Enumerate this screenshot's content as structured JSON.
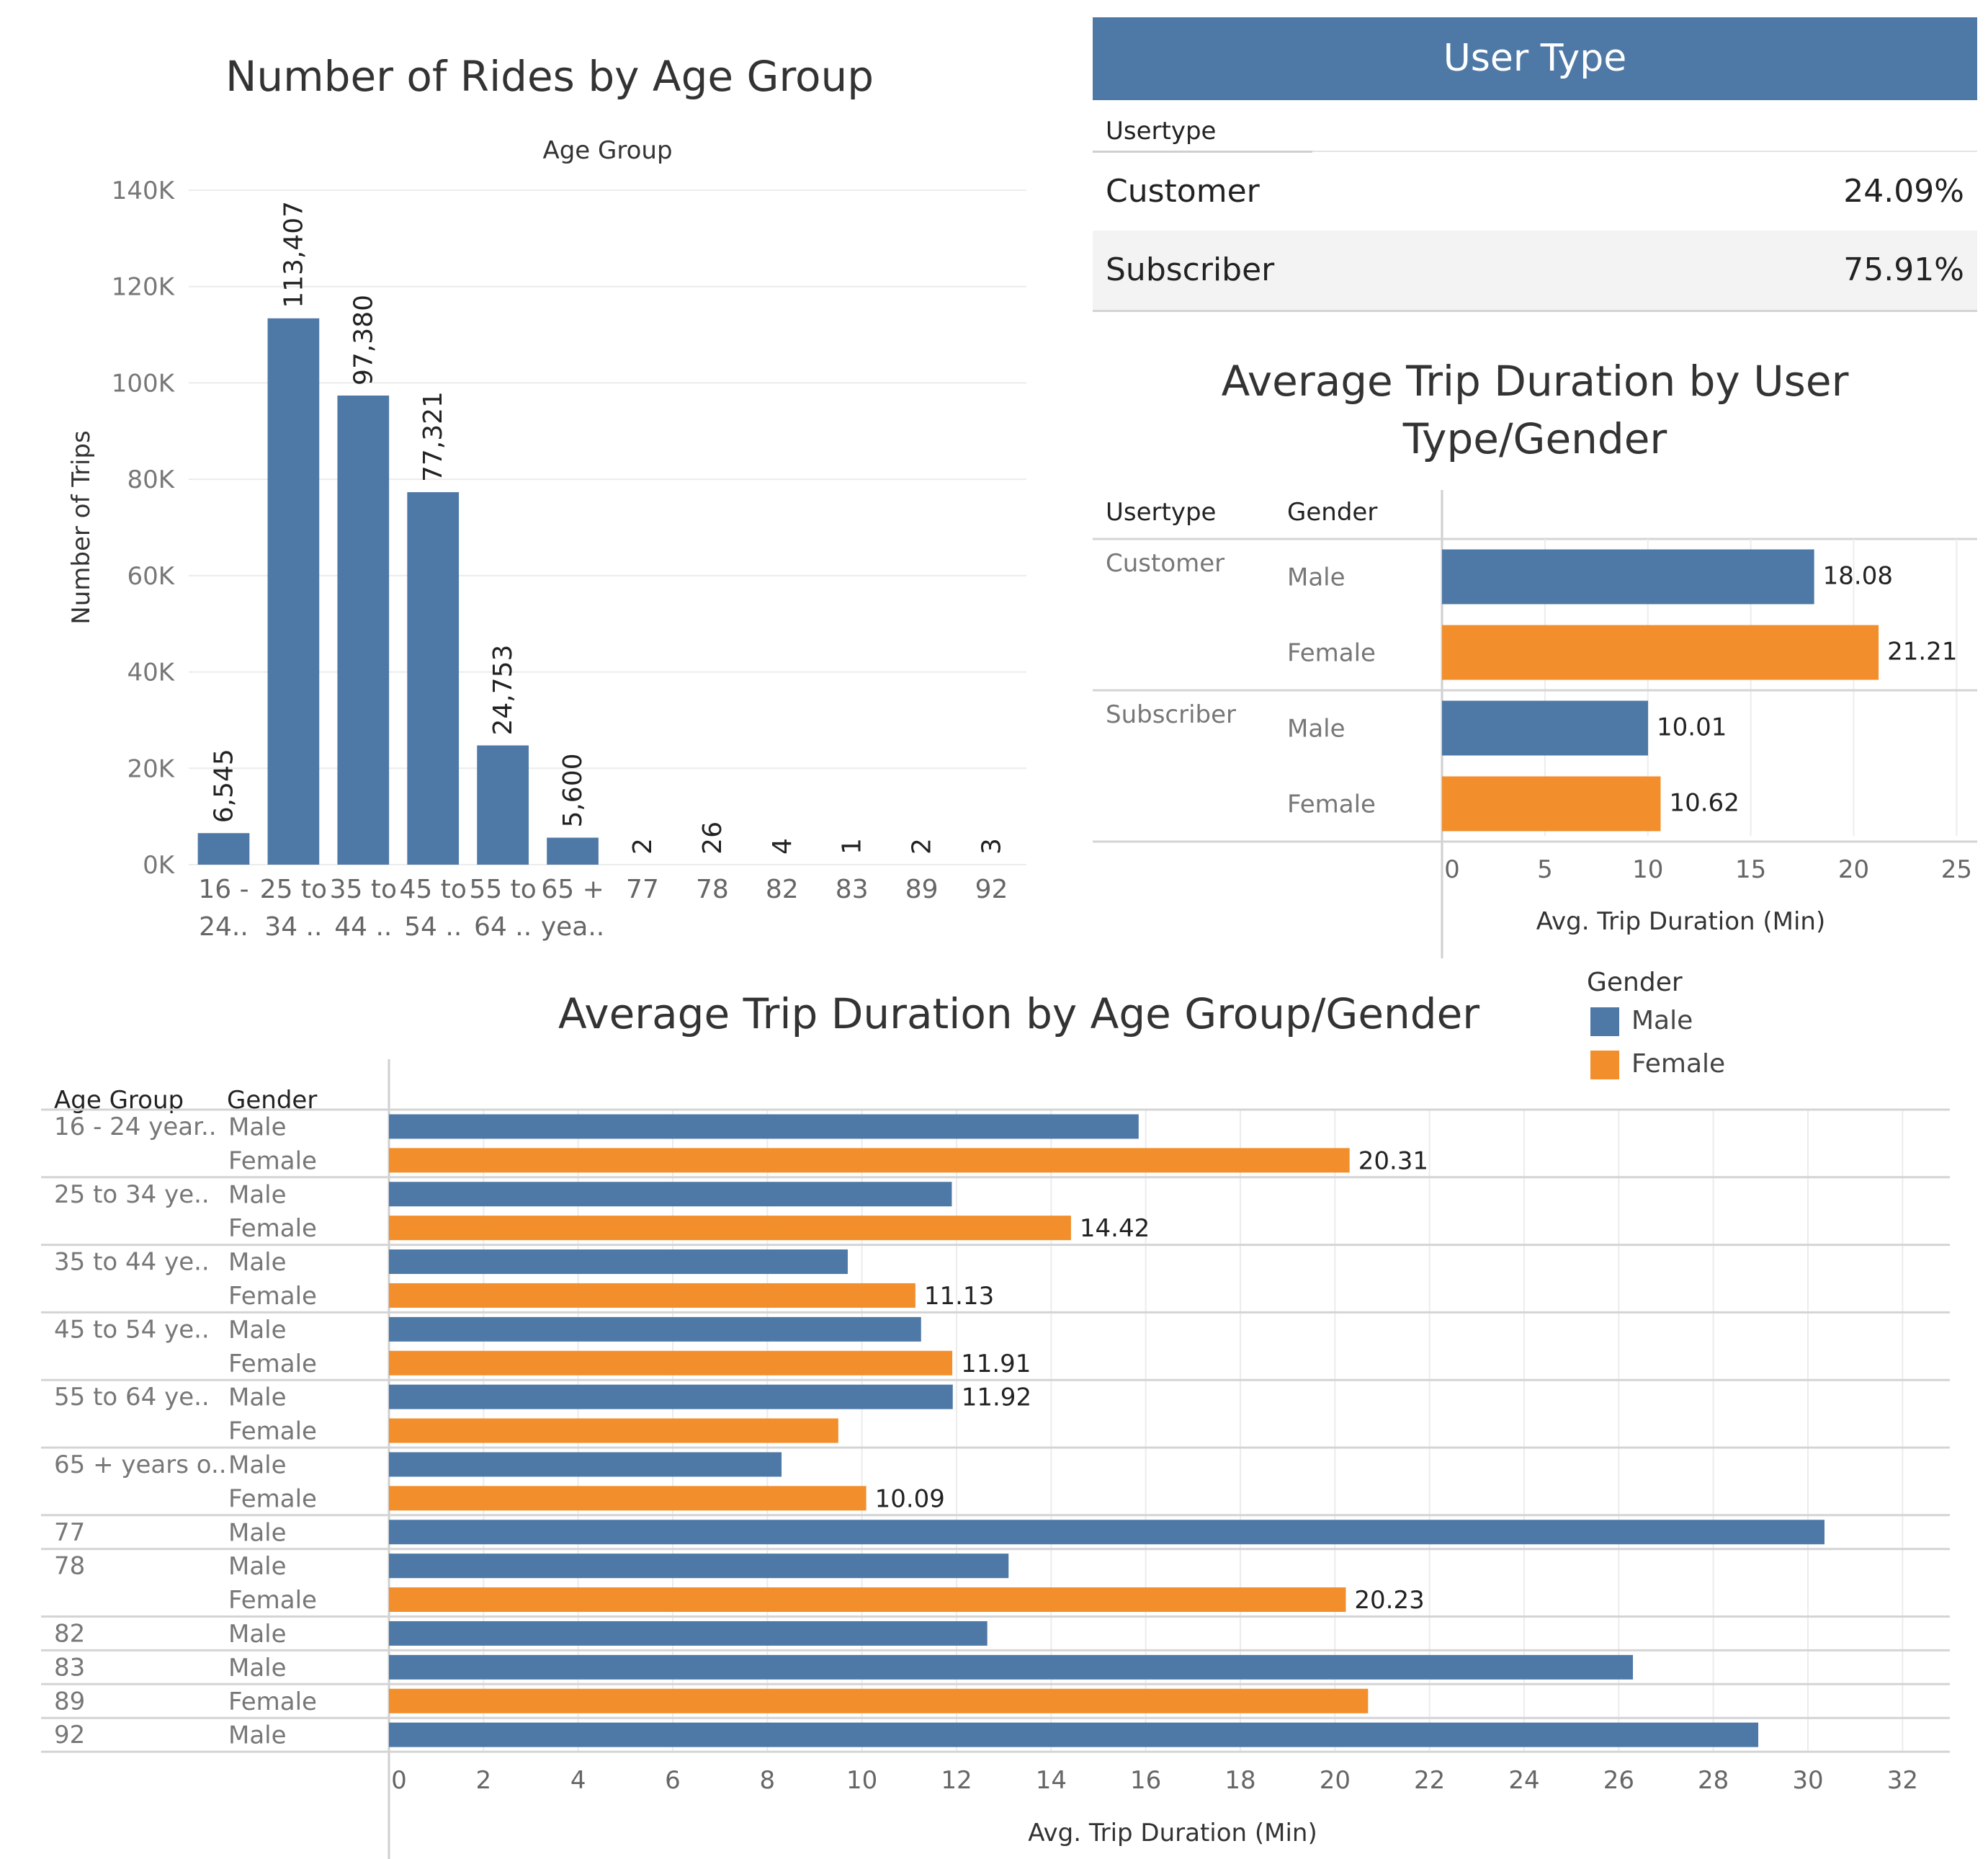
{
  "rides_chart": {
    "title": "Number of Rides by Age Group",
    "chart_data": {
      "type": "bar",
      "title": "Number of Rides by Age Group",
      "xlabel": "Age Group",
      "ylabel": "Number of Trips",
      "ylim": [
        0,
        140000
      ],
      "yticks": [
        "0K",
        "20K",
        "40K",
        "60K",
        "80K",
        "100K",
        "120K",
        "140K"
      ],
      "categories": [
        [
          "16 -",
          "24.."
        ],
        [
          "25 to",
          "34 .."
        ],
        [
          "35 to",
          "44 .."
        ],
        [
          "45 to",
          "54 .."
        ],
        [
          "55 to",
          "64 .."
        ],
        [
          "65 +",
          "yea.."
        ],
        [
          "77"
        ],
        [
          "78"
        ],
        [
          "82"
        ],
        [
          "83"
        ],
        [
          "89"
        ],
        [
          "92"
        ]
      ],
      "values": [
        6545,
        113407,
        97380,
        77321,
        24753,
        5600,
        2,
        26,
        4,
        1,
        2,
        3
      ],
      "data_labels": [
        "6,545",
        "113,407",
        "97,380",
        "77,321",
        "24,753",
        "5,600",
        "2",
        "26",
        "4",
        "1",
        "2",
        "3"
      ],
      "color": "#4e79a7",
      "grid": true
    }
  },
  "user_type": {
    "header": "User Type",
    "column_label": "Usertype",
    "rows": [
      {
        "label": "Customer",
        "value": "24.09%"
      },
      {
        "label": "Subscriber",
        "value": "75.91%"
      }
    ]
  },
  "duration_by_user": {
    "title_line1": "Average Trip Duration by User",
    "title_line2": "Type/Gender",
    "col_usertype": "Usertype",
    "col_gender": "Gender",
    "chart_data": {
      "type": "bar",
      "orientation": "horizontal",
      "xlabel": "Avg. Trip Duration (Min)",
      "xlim": [
        0,
        26
      ],
      "xticks": [
        "0",
        "5",
        "10",
        "15",
        "20",
        "25"
      ],
      "groups": [
        {
          "usertype": "Customer",
          "rows": [
            {
              "gender": "Male",
              "value": 18.08,
              "label": "18.08"
            },
            {
              "gender": "Female",
              "value": 21.21,
              "label": "21.21"
            }
          ]
        },
        {
          "usertype": "Subscriber",
          "rows": [
            {
              "gender": "Male",
              "value": 10.01,
              "label": "10.01"
            },
            {
              "gender": "Female",
              "value": 10.62,
              "label": "10.62"
            }
          ]
        }
      ]
    }
  },
  "duration_by_age": {
    "title": "Average Trip Duration by Age Group/Gender",
    "col_age": "Age Group",
    "col_gender": "Gender",
    "chart_data": {
      "type": "bar",
      "orientation": "horizontal",
      "xlabel": "Avg. Trip Duration (Min)",
      "xlim": [
        0,
        33
      ],
      "xticks": [
        "0",
        "2",
        "4",
        "6",
        "8",
        "10",
        "12",
        "14",
        "16",
        "18",
        "20",
        "22",
        "24",
        "26",
        "28",
        "30",
        "32"
      ],
      "groups": [
        {
          "age": "16 - 24 year..",
          "rows": [
            {
              "gender": "Male",
              "value": 15.85,
              "label": ""
            },
            {
              "gender": "Female",
              "value": 20.31,
              "label": "20.31"
            }
          ]
        },
        {
          "age": "25 to 34 ye..",
          "rows": [
            {
              "gender": "Male",
              "value": 11.9,
              "label": ""
            },
            {
              "gender": "Female",
              "value": 14.42,
              "label": "14.42"
            }
          ]
        },
        {
          "age": "35 to 44 ye..",
          "rows": [
            {
              "gender": "Male",
              "value": 9.7,
              "label": ""
            },
            {
              "gender": "Female",
              "value": 11.13,
              "label": "11.13"
            }
          ]
        },
        {
          "age": "45 to 54 ye..",
          "rows": [
            {
              "gender": "Male",
              "value": 11.25,
              "label": ""
            },
            {
              "gender": "Female",
              "value": 11.91,
              "label": "11.91"
            }
          ]
        },
        {
          "age": "55 to 64 ye..",
          "rows": [
            {
              "gender": "Male",
              "value": 11.92,
              "label": "11.92"
            },
            {
              "gender": "Female",
              "value": 9.5,
              "label": ""
            }
          ]
        },
        {
          "age": "65 + years o..",
          "rows": [
            {
              "gender": "Male",
              "value": 8.3,
              "label": ""
            },
            {
              "gender": "Female",
              "value": 10.09,
              "label": "10.09"
            }
          ]
        },
        {
          "age": "77",
          "rows": [
            {
              "gender": "Male",
              "value": 30.35,
              "label": ""
            }
          ]
        },
        {
          "age": "78",
          "rows": [
            {
              "gender": "Male",
              "value": 13.1,
              "label": ""
            },
            {
              "gender": "Female",
              "value": 20.23,
              "label": "20.23"
            }
          ]
        },
        {
          "age": "82",
          "rows": [
            {
              "gender": "Male",
              "value": 12.65,
              "label": ""
            }
          ]
        },
        {
          "age": "83",
          "rows": [
            {
              "gender": "Male",
              "value": 26.3,
              "label": ""
            }
          ]
        },
        {
          "age": "89",
          "rows": [
            {
              "gender": "Female",
              "value": 20.7,
              "label": ""
            }
          ]
        },
        {
          "age": "92",
          "rows": [
            {
              "gender": "Male",
              "value": 28.95,
              "label": ""
            }
          ]
        }
      ]
    }
  },
  "legend": {
    "title": "Gender",
    "items": [
      {
        "label": "Male",
        "color": "#4e79a7"
      },
      {
        "label": "Female",
        "color": "#f28e2b"
      }
    ]
  }
}
